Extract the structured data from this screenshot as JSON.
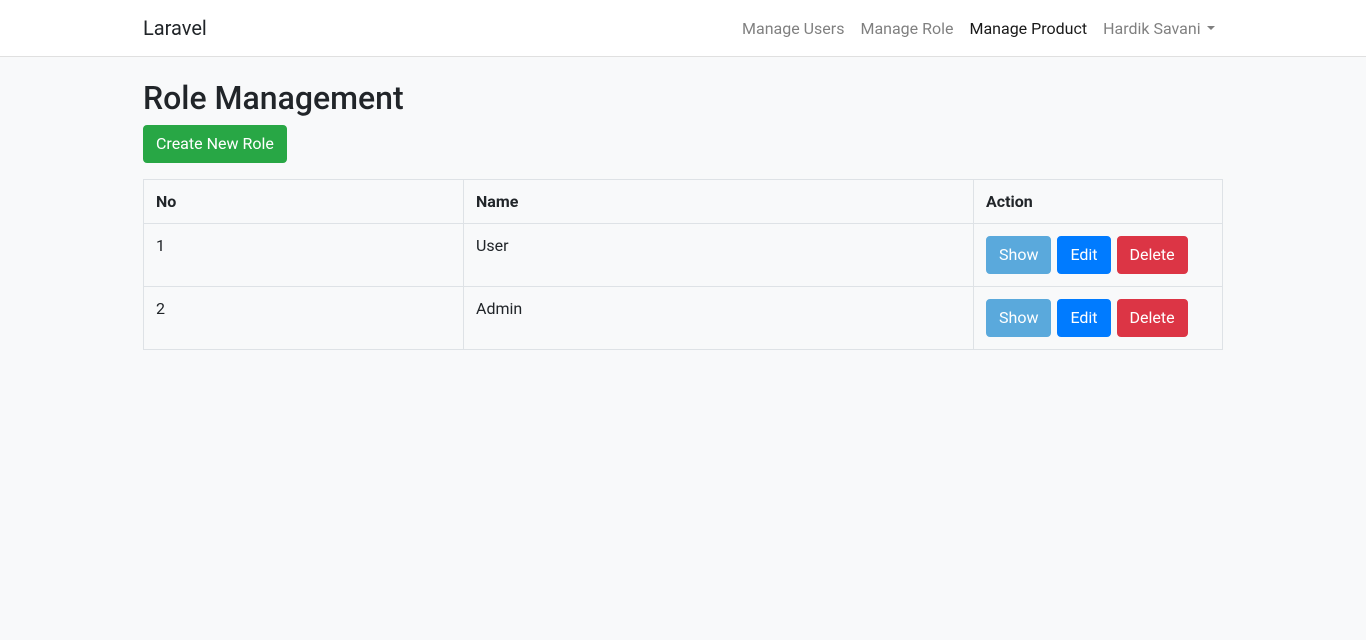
{
  "navbar": {
    "brand": "Laravel",
    "links": [
      {
        "label": "Manage Users",
        "active": false
      },
      {
        "label": "Manage Role",
        "active": false
      },
      {
        "label": "Manage Product",
        "active": true
      }
    ],
    "user_dropdown": {
      "label": "Hardik Savani"
    }
  },
  "page": {
    "title": "Role Management",
    "create_button": "Create New Role"
  },
  "table": {
    "headers": {
      "no": "No",
      "name": "Name",
      "action": "Action"
    },
    "rows": [
      {
        "no": "1",
        "name": "User"
      },
      {
        "no": "2",
        "name": "Admin"
      }
    ],
    "actions": {
      "show": "Show",
      "edit": "Edit",
      "delete": "Delete"
    }
  }
}
